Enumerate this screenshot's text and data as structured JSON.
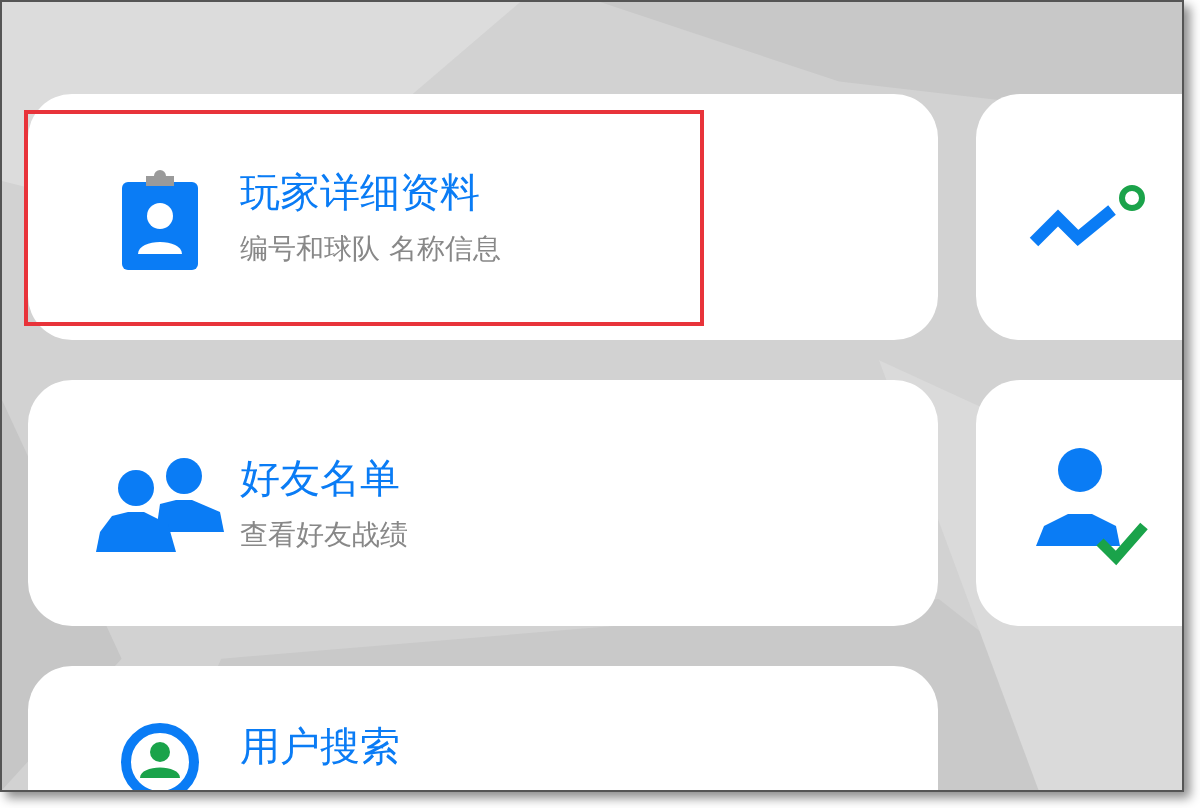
{
  "menu": [
    {
      "title": "玩家详细资料",
      "subtitle": "编号和球队 名称信息",
      "highlighted": true
    },
    {
      "title": "好友名单",
      "subtitle": "查看好友战绩",
      "highlighted": false
    },
    {
      "title": "用户搜索",
      "highlighted": false
    }
  ]
}
